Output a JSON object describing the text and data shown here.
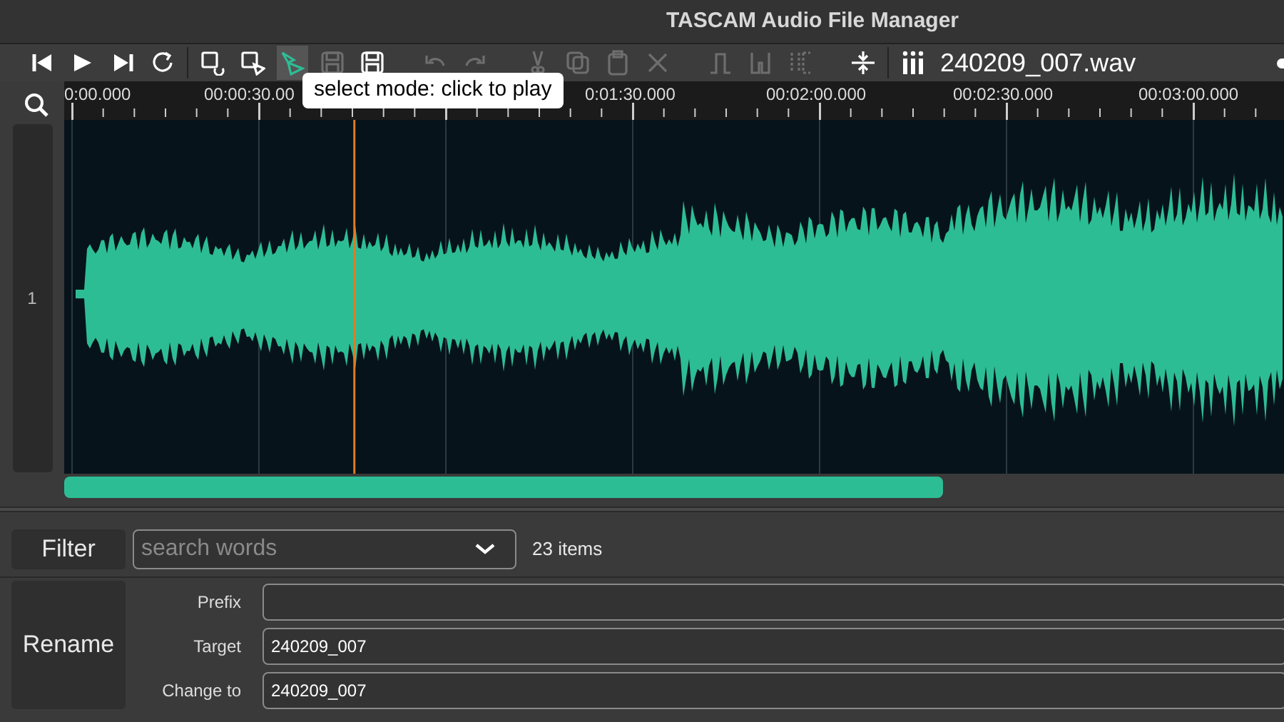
{
  "window": {
    "title": "TASCAM Audio File Manager"
  },
  "toolbar": {
    "tools": [
      {
        "kind": "skip-back",
        "disabled": false,
        "selected": false
      },
      {
        "kind": "play",
        "disabled": false,
        "selected": false
      },
      {
        "kind": "skip-forward",
        "disabled": false,
        "selected": false
      },
      {
        "kind": "loop",
        "disabled": false,
        "selected": false
      },
      {
        "kind": "divider"
      },
      {
        "kind": "select-loop",
        "disabled": false,
        "selected": false
      },
      {
        "kind": "select-play",
        "disabled": false,
        "selected": false
      },
      {
        "kind": "select-mode",
        "disabled": false,
        "selected": true
      },
      {
        "kind": "save",
        "disabled": true,
        "selected": false
      },
      {
        "kind": "save-as",
        "disabled": false,
        "selected": false
      },
      {
        "kind": "gap"
      },
      {
        "kind": "undo",
        "disabled": true,
        "selected": false
      },
      {
        "kind": "redo",
        "disabled": true,
        "selected": false
      },
      {
        "kind": "gap"
      },
      {
        "kind": "cut",
        "disabled": true,
        "selected": false
      },
      {
        "kind": "copy",
        "disabled": true,
        "selected": false
      },
      {
        "kind": "paste",
        "disabled": true,
        "selected": false
      },
      {
        "kind": "delete",
        "disabled": true,
        "selected": false
      },
      {
        "kind": "gap"
      },
      {
        "kind": "fade-in-out",
        "disabled": true,
        "selected": false
      },
      {
        "kind": "notch",
        "disabled": true,
        "selected": false
      },
      {
        "kind": "trim",
        "disabled": true,
        "selected": false
      },
      {
        "kind": "gap"
      },
      {
        "kind": "fit-vertical",
        "disabled": false,
        "selected": false
      },
      {
        "kind": "divider"
      },
      {
        "kind": "meters",
        "disabled": false,
        "selected": false
      }
    ],
    "filename": "240209_007.wav",
    "tooltip": "select mode: click to play"
  },
  "timeline": {
    "labels": [
      "0:00.000",
      "00:00:30.00",
      "0:01:30.000",
      "00:02:00.000",
      "00:02:30.000",
      "00:03:00.000"
    ]
  },
  "track": {
    "label": "1"
  },
  "scrollbar": {
    "level": 0.72
  },
  "filter": {
    "button": "Filter",
    "placeholder": "search words",
    "count": "23 items"
  },
  "rename": {
    "button": "Rename",
    "fields": [
      {
        "label": "Prefix"
      },
      {
        "label": "Target",
        "value": "240209_007"
      },
      {
        "label": "Change to",
        "value": "240209_007"
      }
    ]
  }
}
